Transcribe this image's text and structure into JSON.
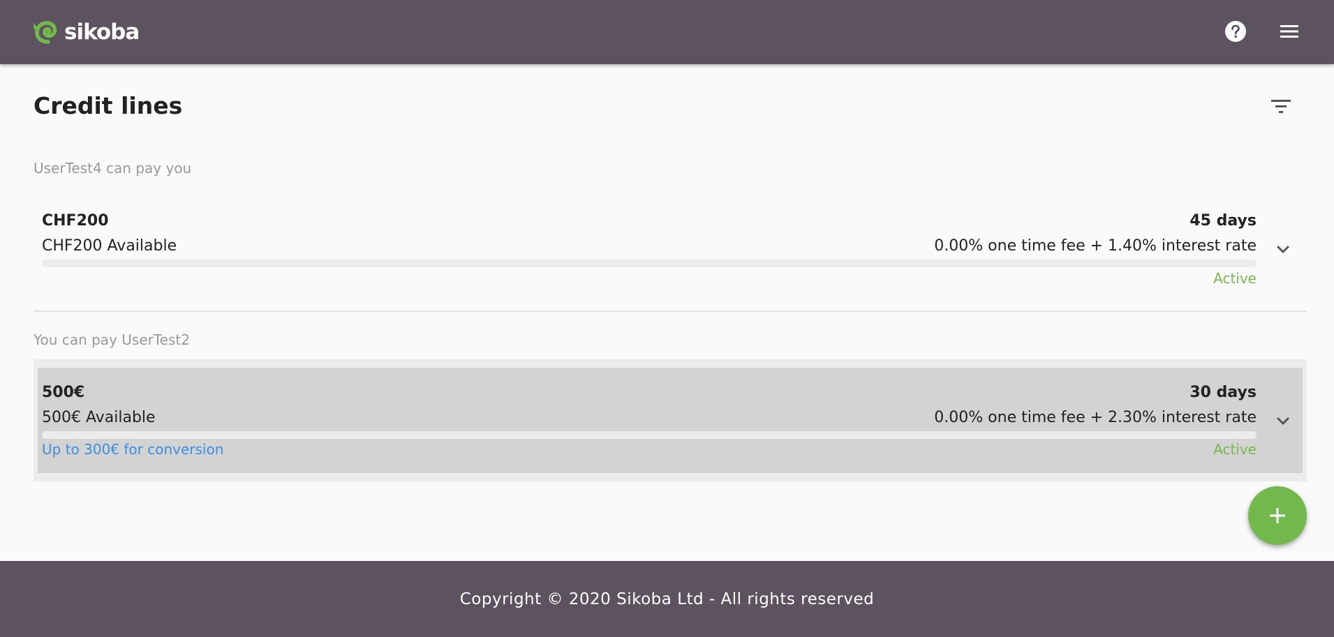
{
  "header": {
    "brand": "sikoba",
    "help_icon": "help-circle-icon",
    "menu_icon": "hamburger-menu-icon",
    "color": "#5d5360"
  },
  "page": {
    "title": "Credit lines",
    "filter_icon": "filter-icon"
  },
  "sections": [
    {
      "label": "UserTest4 can pay you",
      "lines": [
        {
          "amount": "CHF200",
          "days": "45 days",
          "available": "CHF200 Available",
          "rate": "0.00% one time fee + 1.40% interest rate",
          "status": "Active",
          "conversion": ""
        }
      ]
    },
    {
      "label": "You can pay UserTest2",
      "lines": [
        {
          "amount": "500€",
          "days": "30 days",
          "available": "500€ Available",
          "rate": "0.00% one time fee + 2.30% interest rate",
          "status": "Active",
          "conversion": "Up to 300€ for conversion"
        }
      ]
    }
  ],
  "fab": {
    "icon": "plus-icon",
    "color": "#72b84c"
  },
  "footer": {
    "text": "Copyright © 2020 Sikoba Ltd - All rights reserved"
  },
  "colors": {
    "status_active": "#79b74f",
    "link": "#3b8fe0",
    "accent": "#72b84c"
  }
}
